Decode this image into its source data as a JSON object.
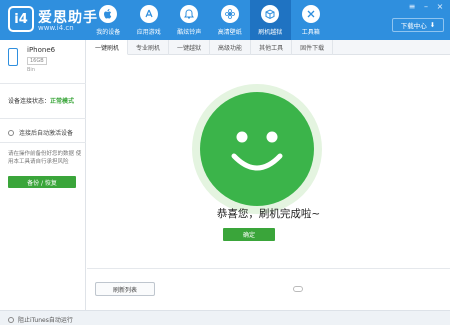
{
  "header": {
    "logo_mark": "i4",
    "app_name": "爱思助手",
    "site": "www.i4.cn",
    "download_label": "下载中心",
    "nav": [
      {
        "label": "我的设备",
        "icon": "apple-icon"
      },
      {
        "label": "应用游戏",
        "icon": "app-store-icon"
      },
      {
        "label": "酷炫铃声",
        "icon": "bell-icon"
      },
      {
        "label": "高清壁纸",
        "icon": "flower-icon"
      },
      {
        "label": "刷机越狱",
        "icon": "box-icon",
        "active": true
      },
      {
        "label": "工具箱",
        "icon": "toolbox-icon"
      }
    ]
  },
  "sidebar": {
    "device_name": "iPhone6",
    "device_capacity": "16GB",
    "device_sub": "Bin",
    "conn_label": "设备连接状态：",
    "conn_value": "正常模式",
    "radio_label": "连接后自动激活设备",
    "tip": "请在操作前备份好您的数据 使用本工具请自行承担风险",
    "backup_label": "备份 / 恢复"
  },
  "tabs": [
    "一键刷机",
    "专业刷机",
    "一键越狱",
    "高级功能",
    "其他工具",
    "固件下载"
  ],
  "main": {
    "success_text": "恭喜您，刷机完成啦~",
    "confirm_label": "确定",
    "refresh_label": "刷新列表"
  },
  "footer": {
    "itunes_label": "阻止iTunes自动运行"
  },
  "colors": {
    "brand_blue": "#2f8fde",
    "success_green": "#3aa53a",
    "smiley_green": "#3bb44a"
  }
}
